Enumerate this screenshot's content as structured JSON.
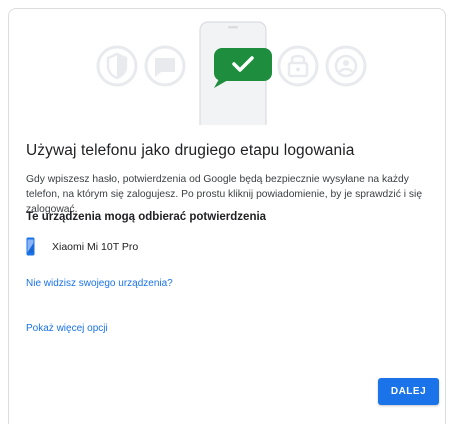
{
  "colors": {
    "accent": "#1a73e8",
    "success": "#1e8e3e",
    "illustration_grey": "#e8eaed",
    "text_primary": "#202124",
    "text_secondary": "#3c4043"
  },
  "illustration": {
    "icons": [
      "shield-icon",
      "chat-bubble-icon",
      "checkmark-icon",
      "lock-icon",
      "account-icon"
    ]
  },
  "main": {
    "title": "Używaj telefonu jako drugiego etapu logowania",
    "description": "Gdy wpiszesz hasło, potwierdzenia od Google będą bezpiecznie wysyłane na każdy telefon, na którym się zalogujesz. Po prostu kliknij powiadomienie, by je sprawdzić i się zalogować.",
    "devices_heading": "Te urządzenia mogą odbierać potwierdzenia",
    "devices": [
      {
        "name": "Xiaomi Mi 10T Pro",
        "icon": "phone-icon"
      }
    ],
    "missing_device_link": "Nie widzisz swojego urządzenia?",
    "more_options_link": "Pokaż więcej opcji",
    "next_button": "DALEJ"
  }
}
